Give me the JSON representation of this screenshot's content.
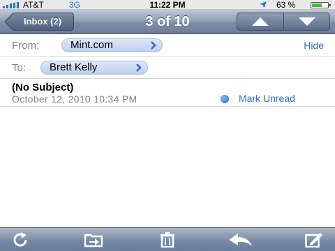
{
  "status_bar": {
    "carrier": "AT&T",
    "network": "3G",
    "time": "11:22 PM",
    "battery_percent": "63 %",
    "battery_level": 0.63,
    "signal_icon": "signal-bars-icon",
    "location_icon": "location-arrow-icon"
  },
  "nav": {
    "back_label": "Inbox (2)",
    "title": "3 of 10",
    "prev_icon": "arrow-up-icon",
    "next_icon": "arrow-down-icon"
  },
  "message": {
    "from_label": "From:",
    "from_value": "Mint.com",
    "hide_label": "Hide",
    "to_label": "To:",
    "to_value": "Brett Kelly",
    "subject": "(No Subject)",
    "date": "October 12, 2010 10:34 PM",
    "mark_unread_label": "Mark Unread"
  },
  "toolbar": {
    "items": [
      "refresh-icon",
      "move-to-folder-icon",
      "trash-icon",
      "reply-icon",
      "compose-icon"
    ]
  },
  "colors": {
    "accent": "#2f6bd4",
    "nav_bar": "#7e8ea6",
    "battery": "#47b93a"
  }
}
